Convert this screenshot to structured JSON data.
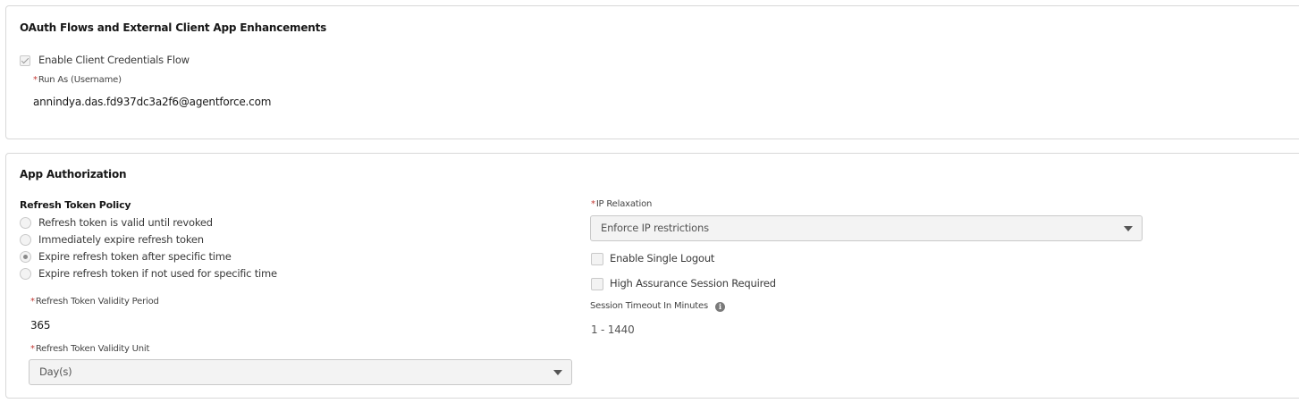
{
  "oauth_section": {
    "title": "OAuth Flows and External Client App Enhancements",
    "client_credentials_label": "Enable Client Credentials Flow",
    "client_credentials_checked": true,
    "run_as_label": "Run As (Username)",
    "run_as_value": "annindya.das.fd937dc3a2f6@agentforce.com",
    "required_mark": "*"
  },
  "auth_section": {
    "title": "App Authorization",
    "refresh_policy_label": "Refresh Token Policy",
    "refresh_options": [
      {
        "label": "Refresh token is valid until revoked",
        "selected": false
      },
      {
        "label": "Immediately expire refresh token",
        "selected": false
      },
      {
        "label": "Expire refresh token after specific time",
        "selected": true
      },
      {
        "label": "Expire refresh token if not used for specific time",
        "selected": false
      }
    ],
    "validity_period_label": "Refresh Token Validity Period",
    "validity_period_value": "365",
    "validity_unit_label": "Refresh Token Validity Unit",
    "validity_unit_value": "Day(s)",
    "ip_relaxation_label": "IP Relaxation",
    "ip_relaxation_value": "Enforce IP restrictions",
    "single_logout_label": "Enable Single Logout",
    "single_logout_checked": false,
    "high_assurance_label": "High Assurance Session Required",
    "high_assurance_checked": false,
    "session_timeout_label": "Session Timeout In Minutes",
    "session_timeout_placeholder": "1 - 1440",
    "required_mark": "*"
  }
}
